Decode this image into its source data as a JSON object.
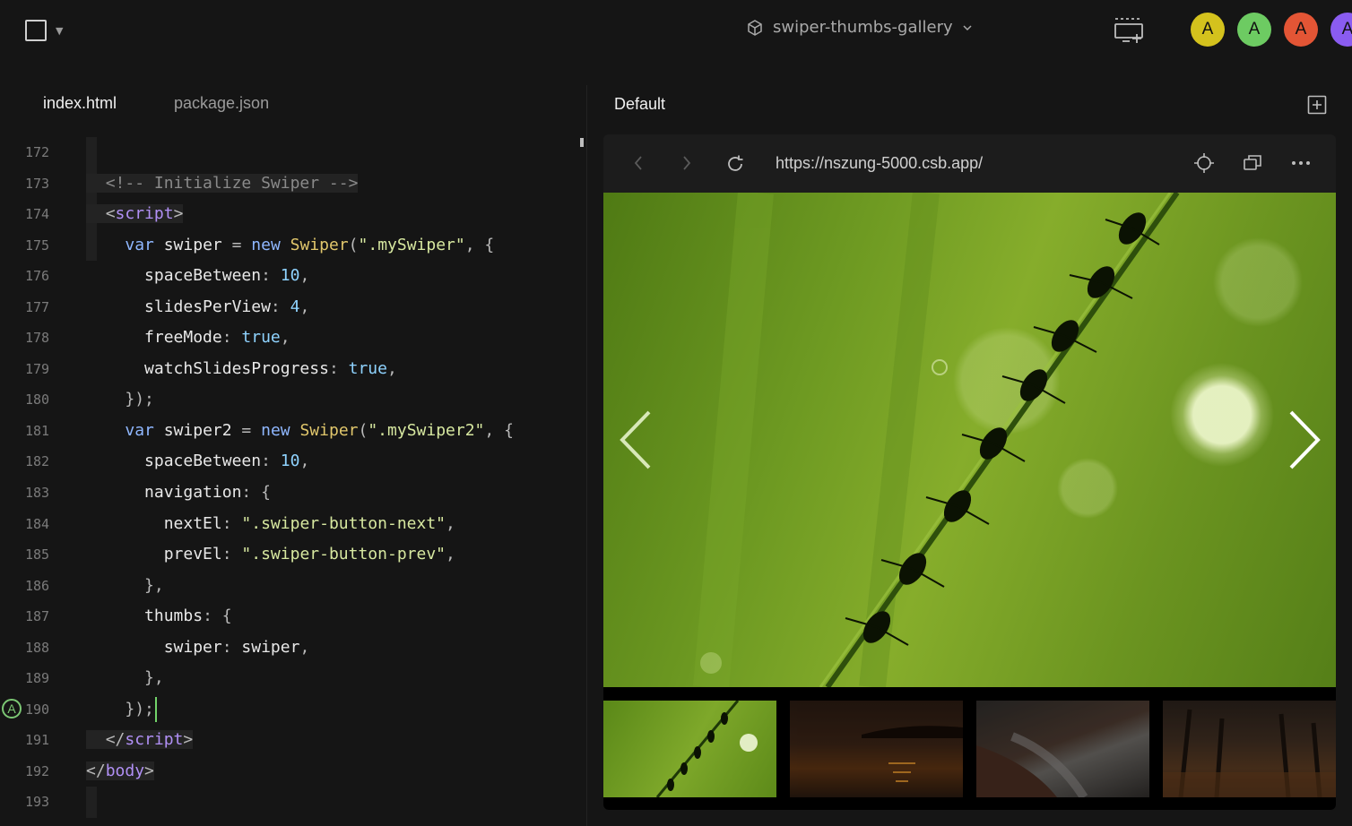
{
  "topbar": {
    "project_name": "swiper-thumbs-gallery",
    "avatars": [
      {
        "initial": "A",
        "color": "#d4c21d"
      },
      {
        "initial": "A",
        "color": "#6dcb62"
      },
      {
        "initial": "A",
        "color": "#e35535"
      },
      {
        "initial": "A",
        "color": "#8a5cf0"
      }
    ]
  },
  "editor": {
    "tabs": [
      {
        "label": "index.html",
        "active": true
      },
      {
        "label": "package.json",
        "active": false
      }
    ],
    "gutter_avatar": "A",
    "line_numbers": [
      "172",
      "173",
      "174",
      "175",
      "176",
      "177",
      "178",
      "179",
      "180",
      "181",
      "182",
      "183",
      "184",
      "185",
      "186",
      "187",
      "188",
      "189",
      "190",
      "191",
      "192",
      "193"
    ]
  },
  "preview": {
    "title": "Default",
    "url": "https://nszung-5000.csb.app/",
    "thumbnails": [
      "grass-with-ants",
      "sunset-lake",
      "rocky-coast",
      "autumn-trees"
    ]
  }
}
